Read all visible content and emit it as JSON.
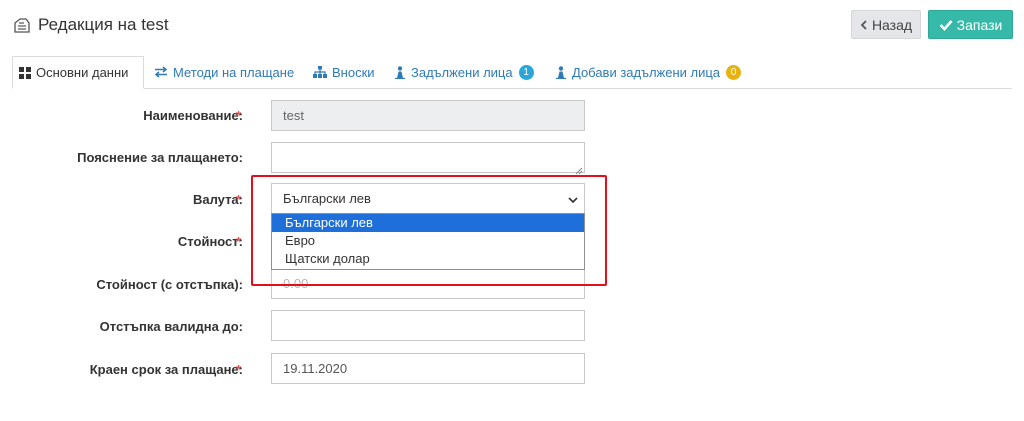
{
  "header": {
    "title": "Редакция на test",
    "icon": "edit-document-icon"
  },
  "toolbar": {
    "back_label": "Назад",
    "save_label": "Запази",
    "save_color": "#36b9a8"
  },
  "tabs": [
    {
      "label": "Основни данни",
      "icon": "grid-icon",
      "active": true
    },
    {
      "label": "Методи на плащане",
      "icon": "exchange-arrows-icon"
    },
    {
      "label": "Вноски",
      "icon": "sitemap-icon"
    },
    {
      "label": "Задължени лица",
      "icon": "user-tree-icon",
      "badge": "1",
      "badge_color": "#2aa7d8"
    },
    {
      "label": "Добави задължени лица",
      "icon": "user-tree-icon",
      "badge": "0",
      "badge_color": "#e8b30e"
    }
  ],
  "form": {
    "name": {
      "label": "Наименование:",
      "required": true,
      "value": "test"
    },
    "payment_note": {
      "label": "Пояснение за плащането:",
      "value": ""
    },
    "currency": {
      "label": "Валута:",
      "required": true,
      "selected": "Български лев",
      "options": [
        "Български лев",
        "Евро",
        "Щатски долар"
      ]
    },
    "amount": {
      "label": "Стойност:",
      "required": true,
      "value": ""
    },
    "amount_discount": {
      "label": "Стойност (с отстъпка):",
      "value": "0.00"
    },
    "discount_valid_until": {
      "label": "Отстъпка валидна до:",
      "value": ""
    },
    "due_date": {
      "label": "Краен срок за плащане:",
      "required": true,
      "value": "19.11.2020"
    }
  },
  "required_marker": "*"
}
